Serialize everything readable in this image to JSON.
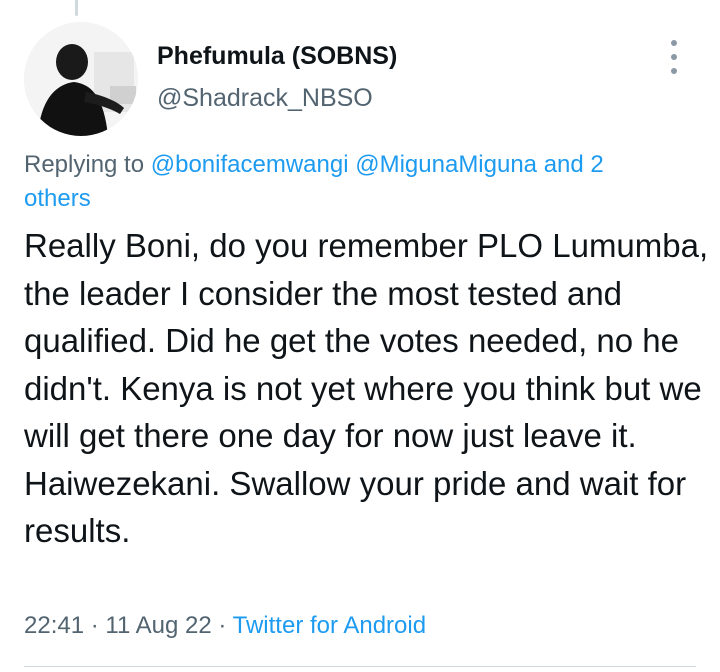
{
  "tweet": {
    "author_name": "Phefumula (SOBNS)",
    "author_handle": "@Shadrack_NBSO",
    "replying_prefix": "Replying to",
    "replying_mention_1": "@bonifacemwangi",
    "replying_mention_2": "@MigunaMiguna",
    "replying_others": "and 2 others",
    "text": "Really Boni, do you remember PLO Lumumba, the leader I consider the most tested and qualified. Did he get the votes needed, no he didn't. Kenya is not yet where you think but we will get there one day for now just leave it. Haiwezekani. Swallow your pride and wait for results.",
    "time": "22:41",
    "separator": "·",
    "date": "11 Aug 22",
    "source": "Twitter for Android"
  },
  "icons": {
    "more": "more-vertical-icon",
    "avatar": "profile-photo"
  },
  "colors": {
    "link": "#1d9bf0",
    "secondary_text": "#536471",
    "primary_text": "#0f1419",
    "divider": "#cfd9de"
  }
}
